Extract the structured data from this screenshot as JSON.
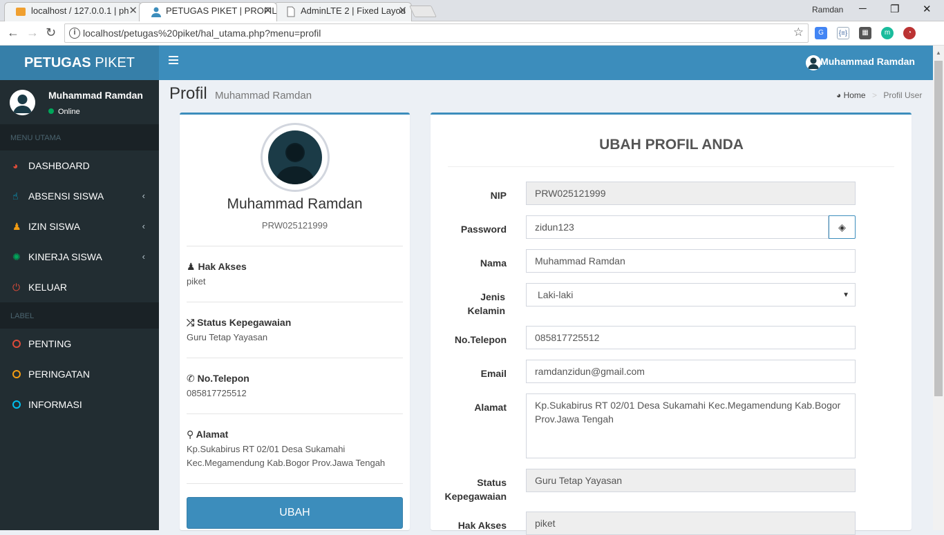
{
  "browser": {
    "tabs": [
      {
        "label": "localhost / 127.0.0.1 | ph",
        "icon": "phpmyadmin-icon"
      },
      {
        "label": "PETUGAS PIKET | PROFIL",
        "icon": "user-icon"
      },
      {
        "label": "AdminLTE 2 | Fixed Layou",
        "icon": "page-icon"
      }
    ],
    "window_user": "Ramdan",
    "url": "localhost/petugas%20piket/hal_utama.php?menu=profil"
  },
  "app": {
    "logo_bold": "PETUGAS",
    "logo_rest": " PIKET",
    "nav_user": "Muhammad Ramdan"
  },
  "sidebar": {
    "user_name": "Muhammad Ramdan",
    "status": "Online",
    "menu_header": "MENU UTAMA",
    "items": [
      {
        "label": "DASHBOARD",
        "icon": "dashboard-icon",
        "color": "#dd4b39"
      },
      {
        "label": "ABSENSI SISWA",
        "icon": "hand-pointer-icon",
        "color": "#00c0ef"
      },
      {
        "label": "IZIN SISWA",
        "icon": "person-icon",
        "color": "#f39c12"
      },
      {
        "label": "KINERJA SISWA",
        "icon": "spinner-icon",
        "color": "#00a65a"
      },
      {
        "label": "KELUAR",
        "icon": "power-icon",
        "color": "#dd4b39"
      }
    ],
    "label_header": "LABEL",
    "labels": [
      {
        "label": "PENTING",
        "color": "#dd4b39"
      },
      {
        "label": "PERINGATAN",
        "color": "#f39c12"
      },
      {
        "label": "INFORMASI",
        "color": "#00c0ef"
      }
    ]
  },
  "content": {
    "title": "Profil",
    "subtitle": "Muhammad Ramdan",
    "breadcrumb_home": "Home",
    "breadcrumb_current": "Profil User"
  },
  "profile": {
    "name": "Muhammad Ramdan",
    "nip": "PRW025121999",
    "hak_akses_label": "Hak Akses",
    "hak_akses": "piket",
    "status_label": "Status Kepegawaian",
    "status": "Guru Tetap Yayasan",
    "telepon_label": "No.Telepon",
    "telepon": "085817725512",
    "alamat_label": "Alamat",
    "alamat": "Kp.Sukabirus RT 02/01 Desa Sukamahi Kec.Megamendung Kab.Bogor Prov.Jawa Tengah",
    "button": "UBAH"
  },
  "form": {
    "title": "UBAH PROFIL ANDA",
    "nip_label": "NIP",
    "nip": "PRW025121999",
    "password_label": "Password",
    "password": "zidun123",
    "nama_label": "Nama",
    "nama": "Muhammad Ramdan",
    "jk_label": "Jenis Kelamin",
    "jk": "Laki-laki",
    "telepon_label": "No.Telepon",
    "telepon": "085817725512",
    "email_label": "Email",
    "email": "ramdanzidun@gmail.com",
    "alamat_label": "Alamat",
    "alamat": "Kp.Sukabirus RT 02/01 Desa Sukamahi Kec.Megamendung Kab.Bogor Prov.Jawa Tengah",
    "status_label": "Status Kepegawaian",
    "status": "Guru Tetap Yayasan",
    "hak_akses_label": "Hak Akses",
    "hak_akses": "piket"
  }
}
